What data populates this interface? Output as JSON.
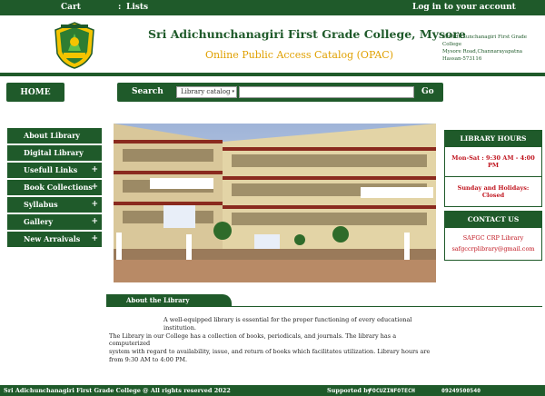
{
  "topbar": {
    "cart": "Cart",
    "lists": "Lists",
    "separator": ":",
    "login": "Log in to your account"
  },
  "header": {
    "college_name": "Sri Adichunchanagiri First Grade College, Mysore",
    "opac_title": "Online Public Access Catalog (OPAC)",
    "address_line1": "Sri Adichunchanagiri First Grade College",
    "address_line2": "Mysore Road,Channarayapatna",
    "address_line3": "Hassan-573116"
  },
  "nav": {
    "home_label": "HOME"
  },
  "search": {
    "label": "Search",
    "catalog_option": "Library catalog",
    "input_value": "",
    "go_label": "Go"
  },
  "sidebar": {
    "items": [
      {
        "label": "About Library",
        "has_submenu": false
      },
      {
        "label": "Digital Library",
        "has_submenu": false
      },
      {
        "label": "Usefull Links",
        "has_submenu": true
      },
      {
        "label": "Book Collections",
        "has_submenu": true
      },
      {
        "label": "Syllabus",
        "has_submenu": true
      },
      {
        "label": "Gallery",
        "has_submenu": true
      },
      {
        "label": "New Arraivals",
        "has_submenu": true
      }
    ],
    "submenu_icon": "+"
  },
  "hours": {
    "title": "LIBRARY HOURS",
    "weekday": "Mon-Sat : 9:30 AM - 4:00 PM",
    "weekend": "Sunday and Holidays: Closed"
  },
  "contact": {
    "title": "CONTACT US",
    "name": "SAFGC CRP Library",
    "email": "safgccrplibrary@gmail.com"
  },
  "about": {
    "heading": "About the Library",
    "line1": "A well-equipped library is essential for the proper functioning of every educational institution.",
    "line2": "The Library in our College has a collection of books, periodicals, and journals. The library has a computerized",
    "line3": "system with regard to availability, issue, and return of books which facilitates utilization. Library hours are",
    "line4": "from 9:30 AM to 4:00 PM."
  },
  "footer": {
    "copyright": "Sri Adichunchanagiri First Grade College @ All rights reserved 2022",
    "supported_by": "Supported by",
    "vendor": "FOCUZINFOTECH",
    "phone": "09249500540"
  },
  "colors": {
    "primary_green": "#1f5a2a",
    "accent_yellow": "#e0a000",
    "alert_red": "#c0141e"
  }
}
